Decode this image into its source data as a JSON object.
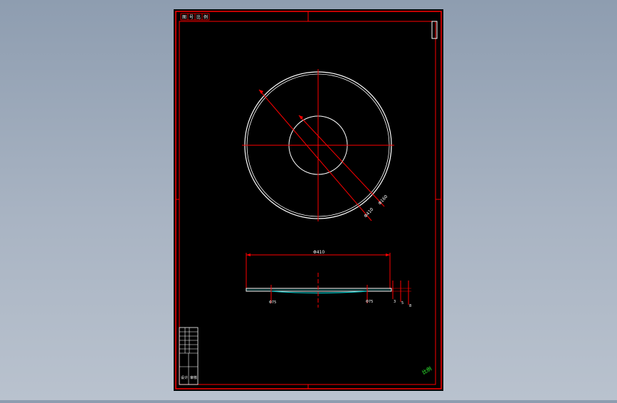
{
  "viewport": {
    "background_top": "#8e9db0",
    "background_bottom": "#b9c2ce"
  },
  "sheet": {
    "background": "#000000",
    "frame_color": "#ff0000",
    "geometry_color": "#ffffff",
    "hatch_color": "#00cccc"
  },
  "top_view": {
    "outer_diameter_label": "Φ410",
    "inner_diameter_label": "Φ160",
    "extra_dim_label": "Φ200"
  },
  "section_view": {
    "overall_width_label": "Φ410",
    "left_label": "Φ75",
    "right_label": "Φ75",
    "thickness_labels": [
      "3",
      "5",
      "8"
    ]
  },
  "corner_note": {
    "text": "比例"
  },
  "title_block": {
    "rows": [
      "",
      "",
      "",
      "",
      "",
      ""
    ],
    "bottom_left": "设计",
    "bottom_right": "审核"
  },
  "top_left_tags": [
    "图",
    "号",
    "比",
    "例"
  ]
}
